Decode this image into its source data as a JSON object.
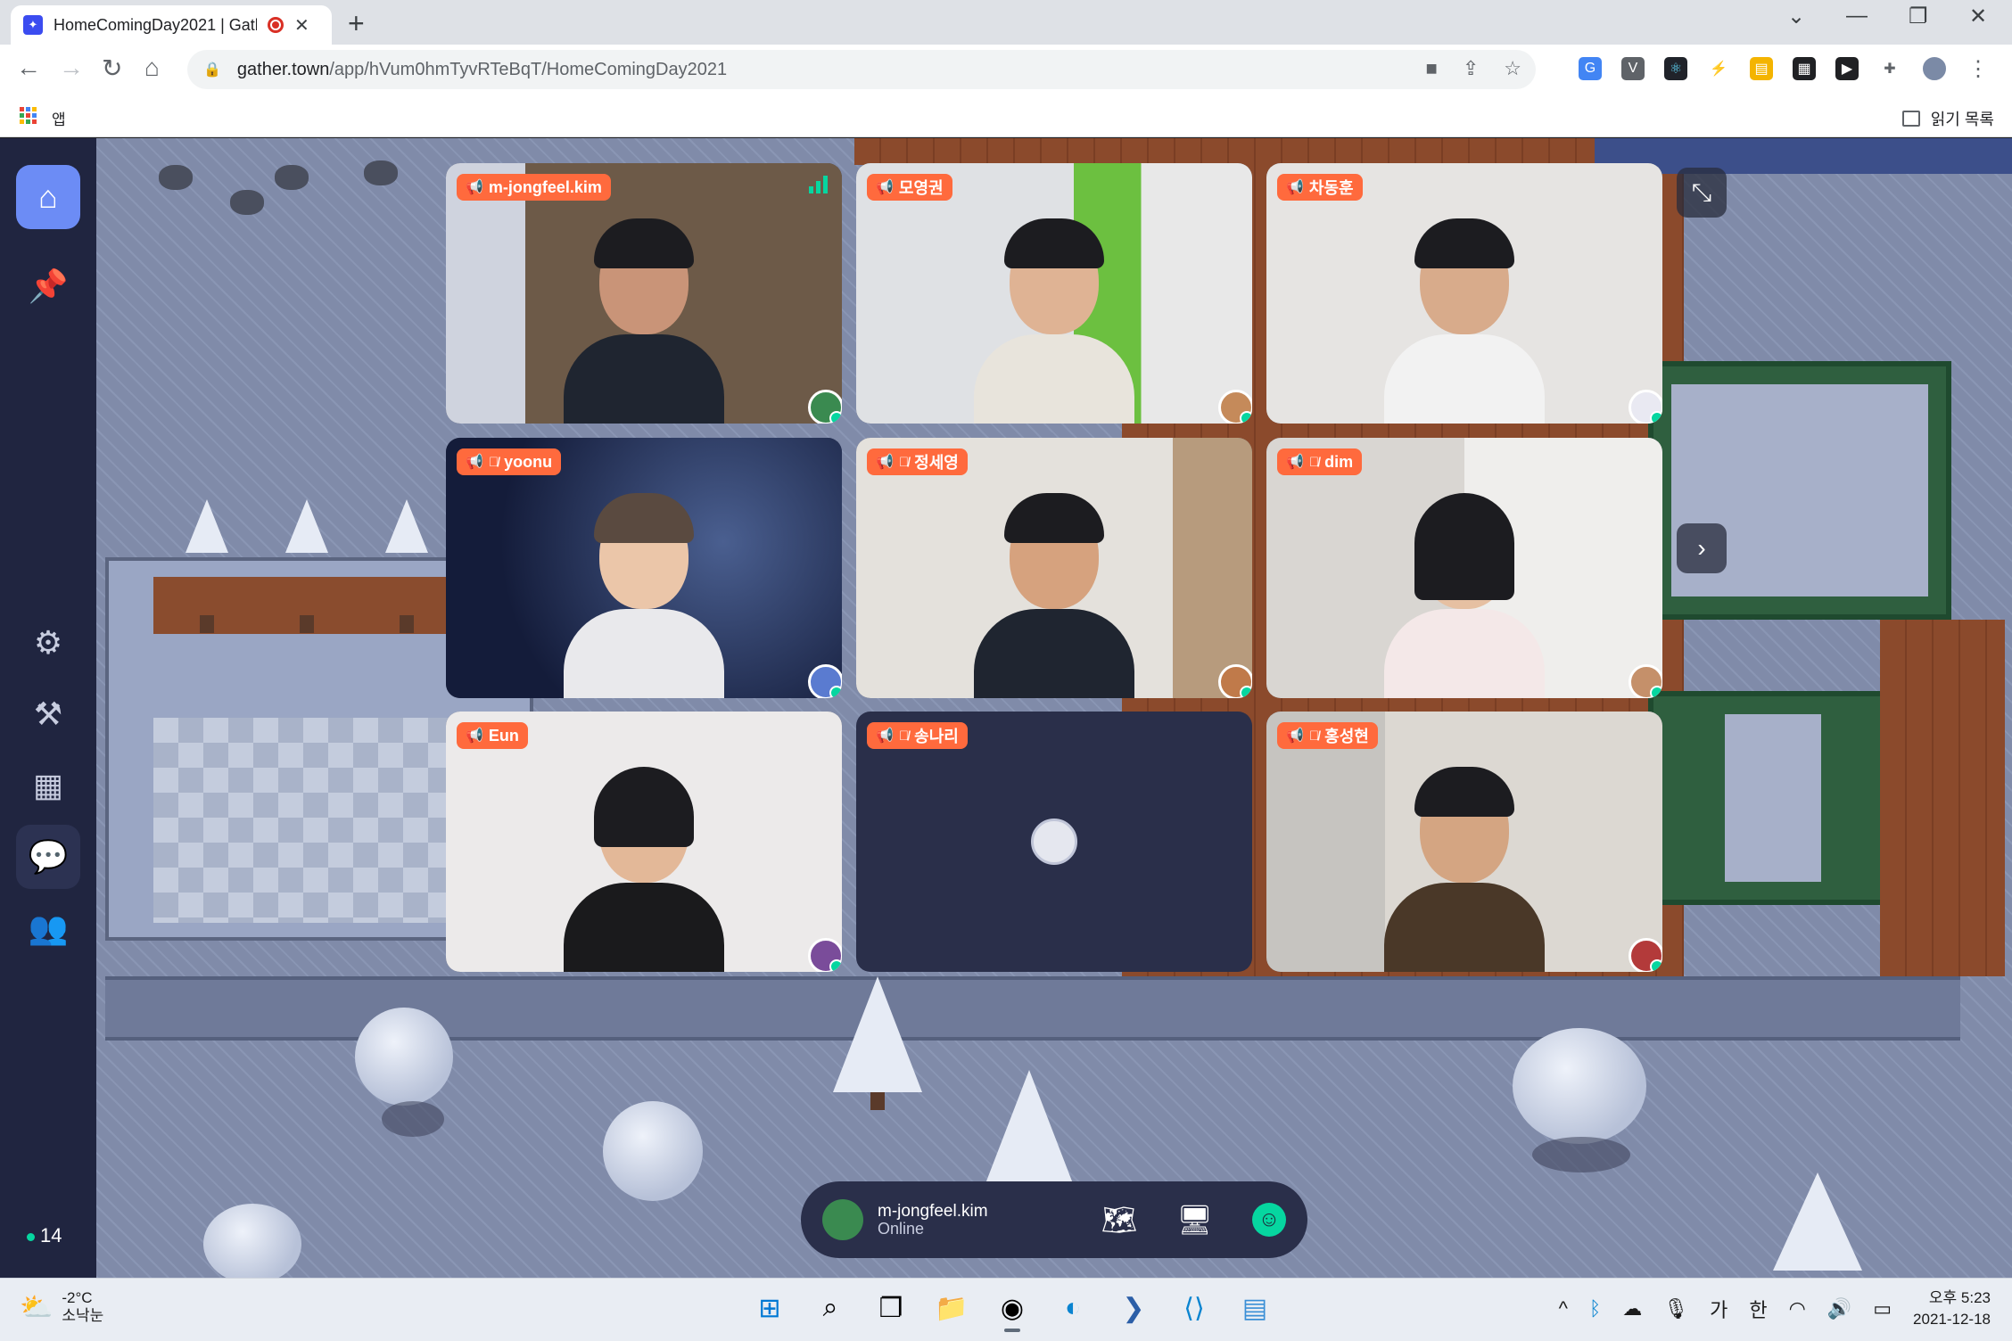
{
  "browser": {
    "tab_title": "HomeComingDay2021 | Gath",
    "url_host": "gather.town",
    "url_path": "/app/hVum0hmTyvRTeBqT/HomeComingDay2021",
    "apps_label": "앱",
    "reading_list": "읽기 목록"
  },
  "sidebar": {
    "online_count": "14"
  },
  "tiles": [
    {
      "name": "m-jongfeel.kim",
      "muted": false
    },
    {
      "name": "모영권",
      "muted": false
    },
    {
      "name": "차동훈",
      "muted": false
    },
    {
      "name": "yoonu",
      "muted": true
    },
    {
      "name": "정세영",
      "muted": true
    },
    {
      "name": "dim",
      "muted": true
    },
    {
      "name": "Eun",
      "muted": false
    },
    {
      "name": "송나리",
      "muted": true
    },
    {
      "name": "홍성현",
      "muted": true
    }
  ],
  "bottom_bar": {
    "user_name": "m-jongfeel.kim",
    "status": "Online"
  },
  "taskbar": {
    "temperature": "-2°C",
    "weather_text": "소낙눈",
    "time": "오후 5:23",
    "date": "2021-12-18",
    "ime_1": "가",
    "ime_2": "한"
  },
  "colors": {
    "name_chip": "#ff6a3d",
    "accent_green": "#06d6a0",
    "sidebar_bg": "#202540",
    "home_active": "#6c8cf5"
  }
}
